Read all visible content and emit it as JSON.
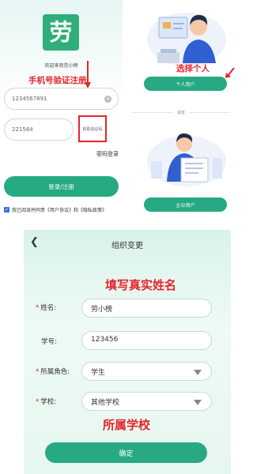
{
  "login": {
    "logo_glyph": "劳",
    "welcome_text": "欢迎来到劳小榜",
    "annotation": "手机号验证注册",
    "phone_value": "1234567891",
    "code_value": "221564",
    "get_code_label": "获取验证码",
    "password_login_label": "密码登录",
    "login_button_label": "登录/注册",
    "agreement_text": "我已阅读并同意《用户协议》和《隐私政策》"
  },
  "identity": {
    "annotation": "选择个人",
    "personal_button_label": "个人用户",
    "divider_text": "或者",
    "enterprise_button_label": "企业用户"
  },
  "org_change": {
    "title": "组织变更",
    "annotation_name": "填写真实姓名",
    "annotation_school": "所属学校",
    "fields": [
      {
        "label": "姓名:",
        "value": "劳小榜",
        "required": true
      },
      {
        "label": "学号:",
        "value": "123456",
        "required": false
      },
      {
        "label": "所属角色:",
        "value": "学生",
        "required": true
      },
      {
        "label": "学校:",
        "value": "其他学校",
        "required": true
      }
    ],
    "confirm_button_label": "确定"
  },
  "colors": {
    "brand_green": "#27a983",
    "annotation_red": "#e8232a",
    "checkbox_blue": "#3b6fd8"
  }
}
